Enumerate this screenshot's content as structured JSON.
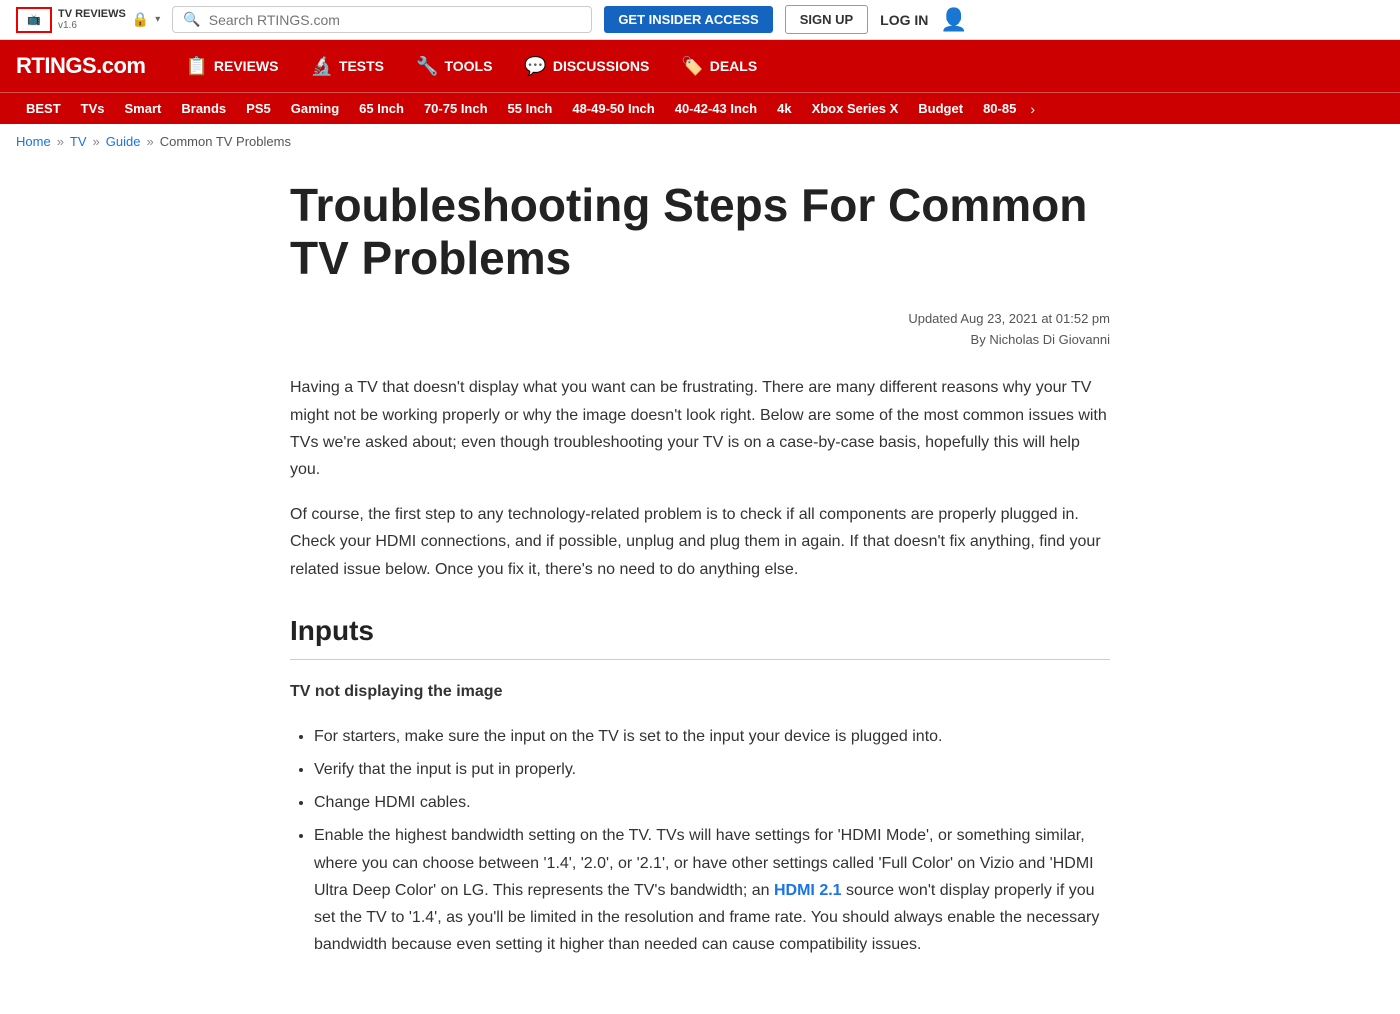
{
  "topbar": {
    "tv_reviews_label": "TV\nREVIEWS",
    "version": "v1.6",
    "search_placeholder": "Search RTINGS.com",
    "insider_btn": "GET INSIDER ACCESS",
    "signup_btn": "SIGN UP",
    "login_btn": "LOG IN"
  },
  "mainnav": {
    "brand": "RTINGS.com",
    "items": [
      {
        "id": "reviews",
        "label": "REVIEWS",
        "icon": "📋"
      },
      {
        "id": "tests",
        "label": "TESTS",
        "icon": "🔬"
      },
      {
        "id": "tools",
        "label": "TOOLS",
        "icon": "🔧"
      },
      {
        "id": "discussions",
        "label": "DISCUSSIONS",
        "icon": "💬"
      },
      {
        "id": "deals",
        "label": "DEALS",
        "icon": "🏷️"
      }
    ]
  },
  "subnav": {
    "items": [
      {
        "id": "best",
        "label": "BEST",
        "active": true
      },
      {
        "id": "tvs",
        "label": "TVs"
      },
      {
        "id": "smart",
        "label": "Smart"
      },
      {
        "id": "brands",
        "label": "Brands"
      },
      {
        "id": "ps5",
        "label": "PS5"
      },
      {
        "id": "gaming",
        "label": "Gaming"
      },
      {
        "id": "65inch",
        "label": "65 Inch"
      },
      {
        "id": "7075inch",
        "label": "70-75 Inch"
      },
      {
        "id": "55inch",
        "label": "55 Inch"
      },
      {
        "id": "484950inch",
        "label": "48-49-50 Inch"
      },
      {
        "id": "404243inch",
        "label": "40-42-43 Inch"
      },
      {
        "id": "4k",
        "label": "4k"
      },
      {
        "id": "xboxseriesx",
        "label": "Xbox Series X"
      },
      {
        "id": "budget",
        "label": "Budget"
      },
      {
        "id": "8085",
        "label": "80-85"
      }
    ]
  },
  "breadcrumb": {
    "items": [
      {
        "label": "Home",
        "href": "#"
      },
      {
        "label": "TV",
        "href": "#"
      },
      {
        "label": "Guide",
        "href": "#"
      },
      {
        "label": "Common TV Problems",
        "href": null
      }
    ]
  },
  "article": {
    "title": "Troubleshooting Steps For Common TV Problems",
    "meta_updated": "Updated Aug 23, 2021 at 01:52 pm",
    "meta_author": "By Nicholas Di Giovanni",
    "intro1": "Having a TV that doesn't display what you want can be frustrating. There are many different reasons why your TV might not be working properly or why the image doesn't look right. Below are some of the most common issues with TVs we're asked about; even though troubleshooting your TV is on a case-by-case basis, hopefully this will help you.",
    "intro2": "Of course, the first step to any technology-related problem is to check if all components are properly plugged in. Check your HDMI connections, and if possible, unplug and plug them in again. If that doesn't fix anything, find your related issue below. Once you fix it, there's no need to do anything else.",
    "section_inputs": "Inputs",
    "subsection_tv_display": "TV not displaying the image",
    "bullets": [
      "For starters, make sure the input on the TV is set to the input your device is plugged into.",
      "Verify that the input is put in properly.",
      "Change HDMI cables.",
      "Enable the highest bandwidth setting on the TV. TVs will have settings for 'HDMI Mode', or something similar, where you can choose between '1.4', '2.0', or '2.1', or have other settings called 'Full Color' on Vizio and 'HDMI Ultra Deep Color' on LG. This represents the TV's bandwidth; an HDMI 2.1 source won't display properly if you set the TV to '1.4', as you'll be limited in the resolution and frame rate. You should always enable the necessary bandwidth because even setting it higher than needed can cause compatibility issues."
    ],
    "hdmi_link_text": "HDMI 2.1"
  }
}
